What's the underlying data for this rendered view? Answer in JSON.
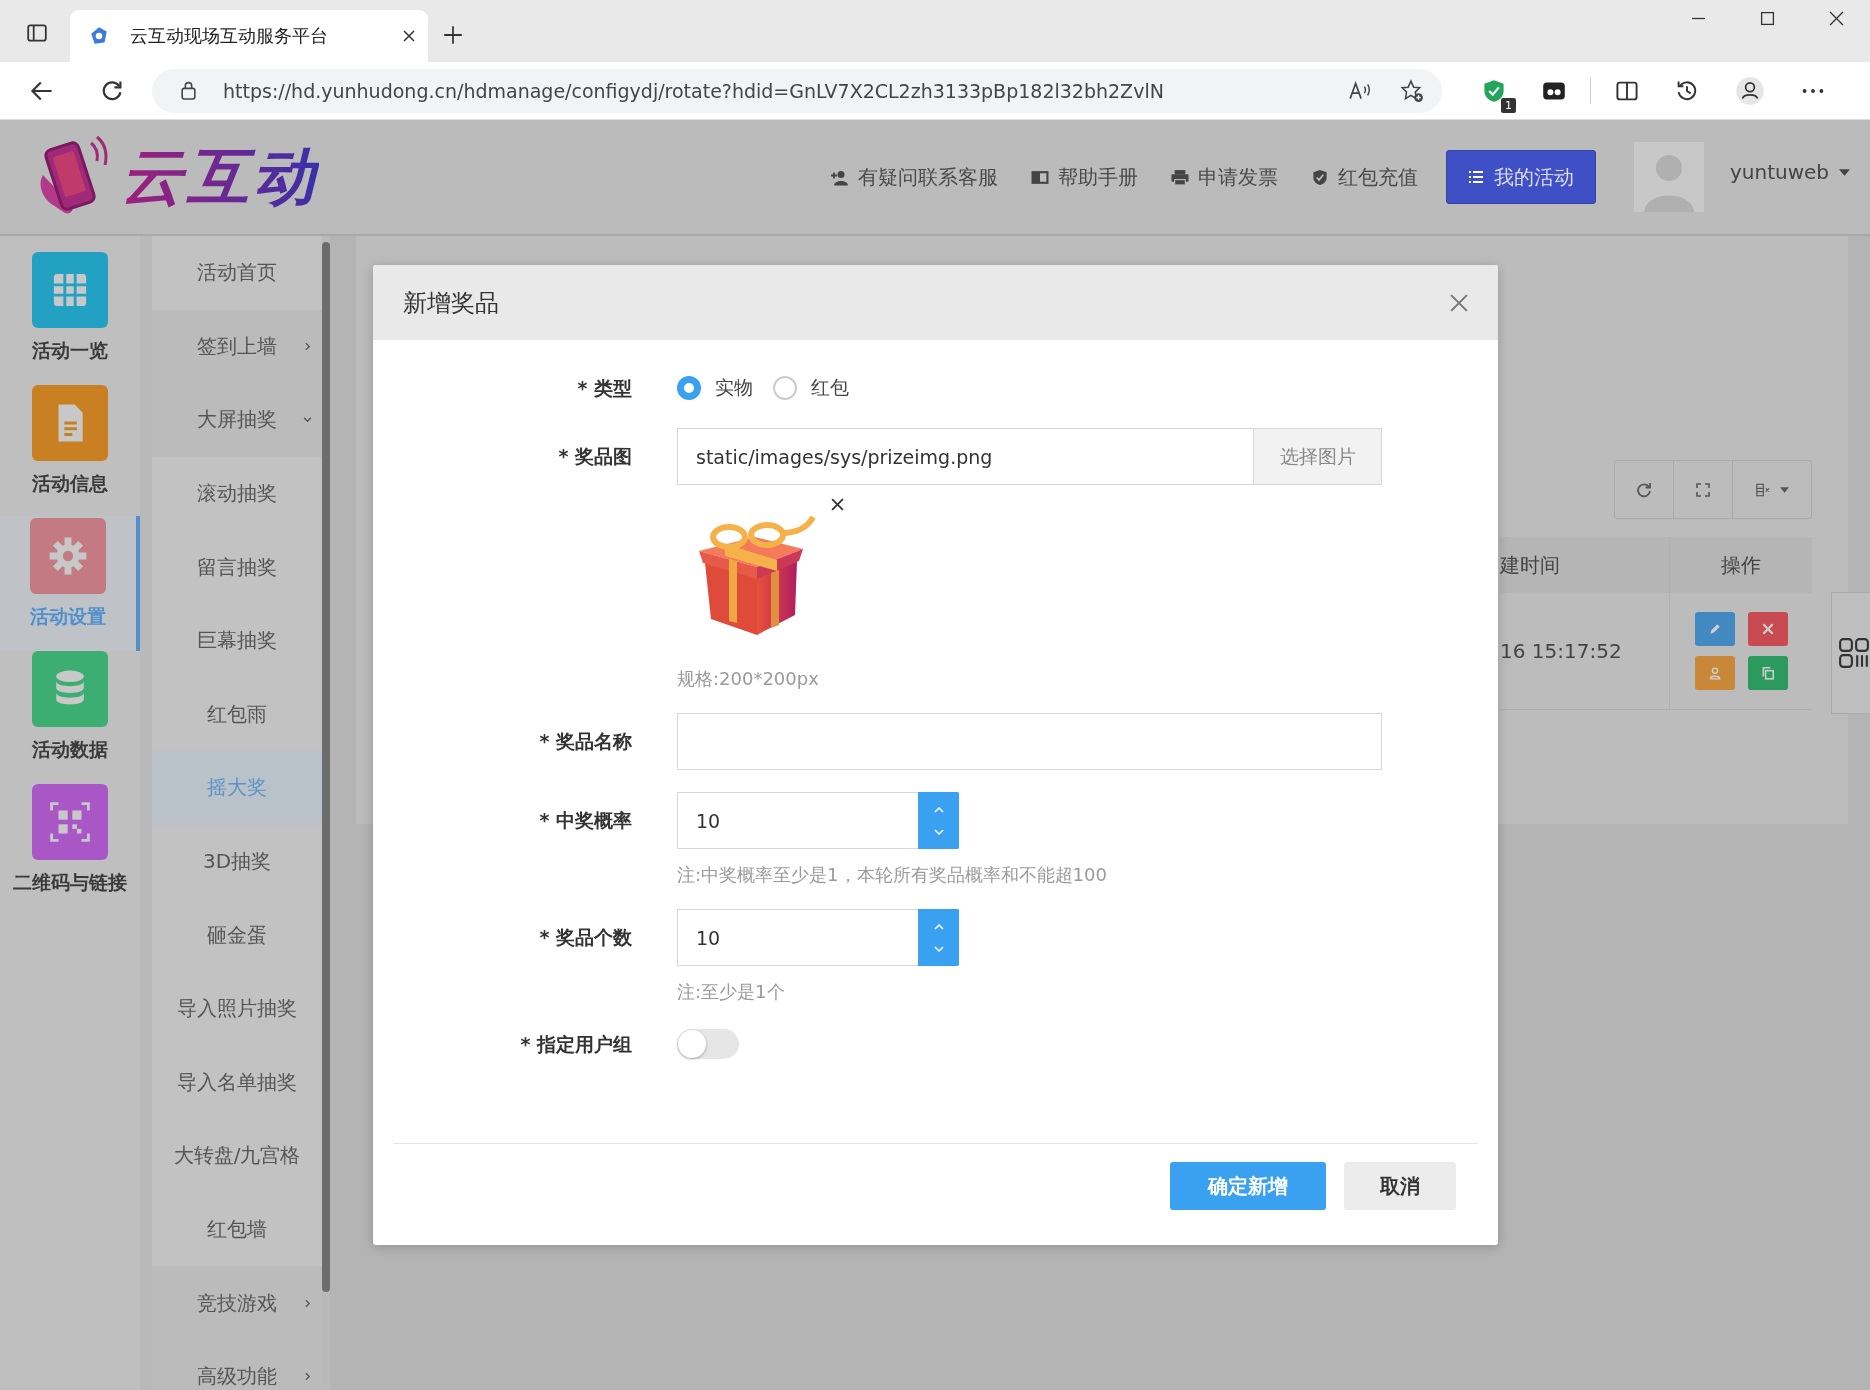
{
  "browser": {
    "tab_title": "云互动现场互动服务平台",
    "url": "https://hd.yunhudong.cn/hdmanage/configydj/rotate?hdid=GnLV7X2CL2zh3133pBp182l32bh2ZvlN",
    "extension_badge": "1"
  },
  "header": {
    "logo_text": "云互动",
    "links": [
      {
        "kind": "support",
        "label": "有疑问联系客服"
      },
      {
        "kind": "manual",
        "label": "帮助手册"
      },
      {
        "kind": "invoice",
        "label": "申请发票"
      },
      {
        "kind": "recharge",
        "label": "红包充值"
      }
    ],
    "my_activity_button": "我的活动",
    "username": "yuntuweb"
  },
  "sidebar": {
    "items": [
      {
        "label": "活动一览",
        "kind": "grid",
        "color": "#23a1c2",
        "selected": false
      },
      {
        "label": "活动信息",
        "kind": "document",
        "color": "#c98022",
        "selected": false
      },
      {
        "label": "活动设置",
        "kind": "gear",
        "color": "#c47a82",
        "selected": true
      },
      {
        "label": "活动数据",
        "kind": "database",
        "color": "#3dae72",
        "selected": false
      },
      {
        "label": "二维码与链接",
        "kind": "qr",
        "color": "#a956c6",
        "selected": false
      }
    ]
  },
  "submenu": {
    "items": [
      {
        "label": "活动首页",
        "selected": false
      },
      {
        "label": "签到上墙",
        "selected": false,
        "expanded": false
      },
      {
        "label": "大屏抽奖",
        "selected": false,
        "expanded": true,
        "children": [
          {
            "label": "滚动抽奖",
            "selected": false
          },
          {
            "label": "留言抽奖",
            "selected": false
          },
          {
            "label": "巨幕抽奖",
            "selected": false
          },
          {
            "label": "红包雨",
            "selected": false
          },
          {
            "label": "摇大奖",
            "selected": true
          },
          {
            "label": "3D抽奖",
            "selected": false
          },
          {
            "label": "砸金蛋",
            "selected": false
          },
          {
            "label": "导入照片抽奖",
            "selected": false
          },
          {
            "label": "导入名单抽奖",
            "selected": false
          },
          {
            "label": "大转盘/九宫格",
            "selected": false
          },
          {
            "label": "红包墙",
            "selected": false
          }
        ]
      },
      {
        "label": "竞技游戏",
        "selected": false,
        "expanded": false
      },
      {
        "label": "高级功能",
        "selected": false,
        "expanded": false
      }
    ]
  },
  "table": {
    "columns": [
      "建时间",
      "操作"
    ],
    "rows": [
      {
        "column_1": "16 15:17:52"
      }
    ]
  },
  "dialog": {
    "title": "新增奖品",
    "fields": [
      {
        "kind": "radio",
        "label": "* 类型",
        "options": [
          {
            "label": "实物",
            "selected": true
          },
          {
            "label": "红包",
            "selected": false
          }
        ]
      },
      {
        "label": "* 奖品图",
        "value": "static/images/sys/prizeimg.png",
        "button": "选择图片",
        "hint": "规格:200*200px"
      },
      {
        "kind": "text",
        "label": "* 奖品名称"
      },
      {
        "kind": "number",
        "label": "* 中奖概率",
        "value": "10",
        "hint": "注:中奖概率至少是1，本轮所有奖品概率和不能超100"
      },
      {
        "kind": "number",
        "label": "* 奖品个数",
        "value": "10",
        "hint": "注:至少是1个"
      },
      {
        "kind": "switch",
        "label": "* 指定用户组",
        "on": false
      }
    ],
    "buttons": [
      {
        "kind": "primary",
        "label": "确定新增"
      },
      {
        "kind": "default",
        "label": "取消"
      }
    ]
  }
}
